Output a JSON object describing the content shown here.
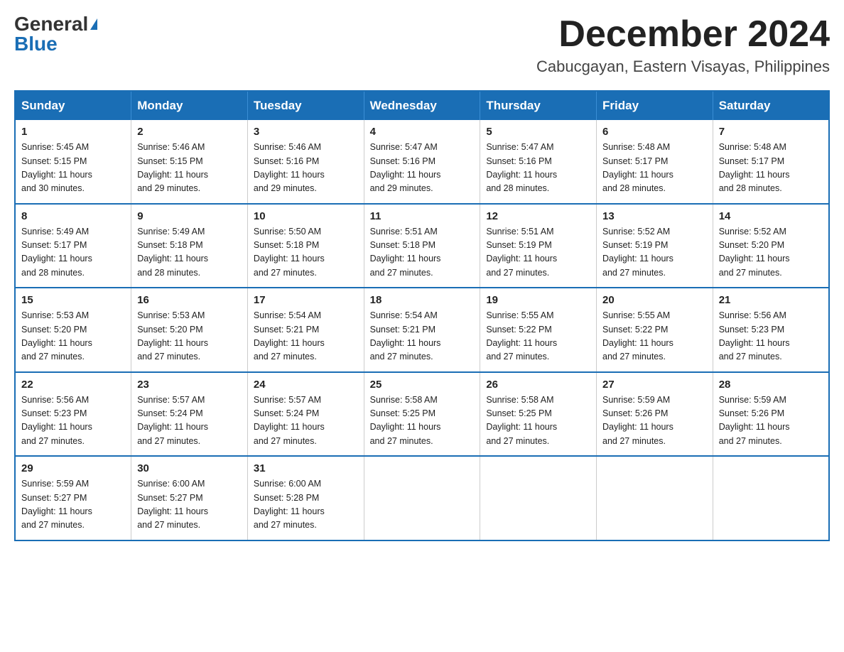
{
  "header": {
    "logo_general": "General",
    "logo_blue": "Blue",
    "month_title": "December 2024",
    "location": "Cabucgayan, Eastern Visayas, Philippines"
  },
  "weekdays": [
    "Sunday",
    "Monday",
    "Tuesday",
    "Wednesday",
    "Thursday",
    "Friday",
    "Saturday"
  ],
  "weeks": [
    [
      {
        "day": "1",
        "sunrise": "5:45 AM",
        "sunset": "5:15 PM",
        "daylight": "11 hours and 30 minutes."
      },
      {
        "day": "2",
        "sunrise": "5:46 AM",
        "sunset": "5:15 PM",
        "daylight": "11 hours and 29 minutes."
      },
      {
        "day": "3",
        "sunrise": "5:46 AM",
        "sunset": "5:16 PM",
        "daylight": "11 hours and 29 minutes."
      },
      {
        "day": "4",
        "sunrise": "5:47 AM",
        "sunset": "5:16 PM",
        "daylight": "11 hours and 29 minutes."
      },
      {
        "day": "5",
        "sunrise": "5:47 AM",
        "sunset": "5:16 PM",
        "daylight": "11 hours and 28 minutes."
      },
      {
        "day": "6",
        "sunrise": "5:48 AM",
        "sunset": "5:17 PM",
        "daylight": "11 hours and 28 minutes."
      },
      {
        "day": "7",
        "sunrise": "5:48 AM",
        "sunset": "5:17 PM",
        "daylight": "11 hours and 28 minutes."
      }
    ],
    [
      {
        "day": "8",
        "sunrise": "5:49 AM",
        "sunset": "5:17 PM",
        "daylight": "11 hours and 28 minutes."
      },
      {
        "day": "9",
        "sunrise": "5:49 AM",
        "sunset": "5:18 PM",
        "daylight": "11 hours and 28 minutes."
      },
      {
        "day": "10",
        "sunrise": "5:50 AM",
        "sunset": "5:18 PM",
        "daylight": "11 hours and 27 minutes."
      },
      {
        "day": "11",
        "sunrise": "5:51 AM",
        "sunset": "5:18 PM",
        "daylight": "11 hours and 27 minutes."
      },
      {
        "day": "12",
        "sunrise": "5:51 AM",
        "sunset": "5:19 PM",
        "daylight": "11 hours and 27 minutes."
      },
      {
        "day": "13",
        "sunrise": "5:52 AM",
        "sunset": "5:19 PM",
        "daylight": "11 hours and 27 minutes."
      },
      {
        "day": "14",
        "sunrise": "5:52 AM",
        "sunset": "5:20 PM",
        "daylight": "11 hours and 27 minutes."
      }
    ],
    [
      {
        "day": "15",
        "sunrise": "5:53 AM",
        "sunset": "5:20 PM",
        "daylight": "11 hours and 27 minutes."
      },
      {
        "day": "16",
        "sunrise": "5:53 AM",
        "sunset": "5:20 PM",
        "daylight": "11 hours and 27 minutes."
      },
      {
        "day": "17",
        "sunrise": "5:54 AM",
        "sunset": "5:21 PM",
        "daylight": "11 hours and 27 minutes."
      },
      {
        "day": "18",
        "sunrise": "5:54 AM",
        "sunset": "5:21 PM",
        "daylight": "11 hours and 27 minutes."
      },
      {
        "day": "19",
        "sunrise": "5:55 AM",
        "sunset": "5:22 PM",
        "daylight": "11 hours and 27 minutes."
      },
      {
        "day": "20",
        "sunrise": "5:55 AM",
        "sunset": "5:22 PM",
        "daylight": "11 hours and 27 minutes."
      },
      {
        "day": "21",
        "sunrise": "5:56 AM",
        "sunset": "5:23 PM",
        "daylight": "11 hours and 27 minutes."
      }
    ],
    [
      {
        "day": "22",
        "sunrise": "5:56 AM",
        "sunset": "5:23 PM",
        "daylight": "11 hours and 27 minutes."
      },
      {
        "day": "23",
        "sunrise": "5:57 AM",
        "sunset": "5:24 PM",
        "daylight": "11 hours and 27 minutes."
      },
      {
        "day": "24",
        "sunrise": "5:57 AM",
        "sunset": "5:24 PM",
        "daylight": "11 hours and 27 minutes."
      },
      {
        "day": "25",
        "sunrise": "5:58 AM",
        "sunset": "5:25 PM",
        "daylight": "11 hours and 27 minutes."
      },
      {
        "day": "26",
        "sunrise": "5:58 AM",
        "sunset": "5:25 PM",
        "daylight": "11 hours and 27 minutes."
      },
      {
        "day": "27",
        "sunrise": "5:59 AM",
        "sunset": "5:26 PM",
        "daylight": "11 hours and 27 minutes."
      },
      {
        "day": "28",
        "sunrise": "5:59 AM",
        "sunset": "5:26 PM",
        "daylight": "11 hours and 27 minutes."
      }
    ],
    [
      {
        "day": "29",
        "sunrise": "5:59 AM",
        "sunset": "5:27 PM",
        "daylight": "11 hours and 27 minutes."
      },
      {
        "day": "30",
        "sunrise": "6:00 AM",
        "sunset": "5:27 PM",
        "daylight": "11 hours and 27 minutes."
      },
      {
        "day": "31",
        "sunrise": "6:00 AM",
        "sunset": "5:28 PM",
        "daylight": "11 hours and 27 minutes."
      },
      null,
      null,
      null,
      null
    ]
  ],
  "labels": {
    "sunrise": "Sunrise:",
    "sunset": "Sunset:",
    "daylight": "Daylight:"
  }
}
